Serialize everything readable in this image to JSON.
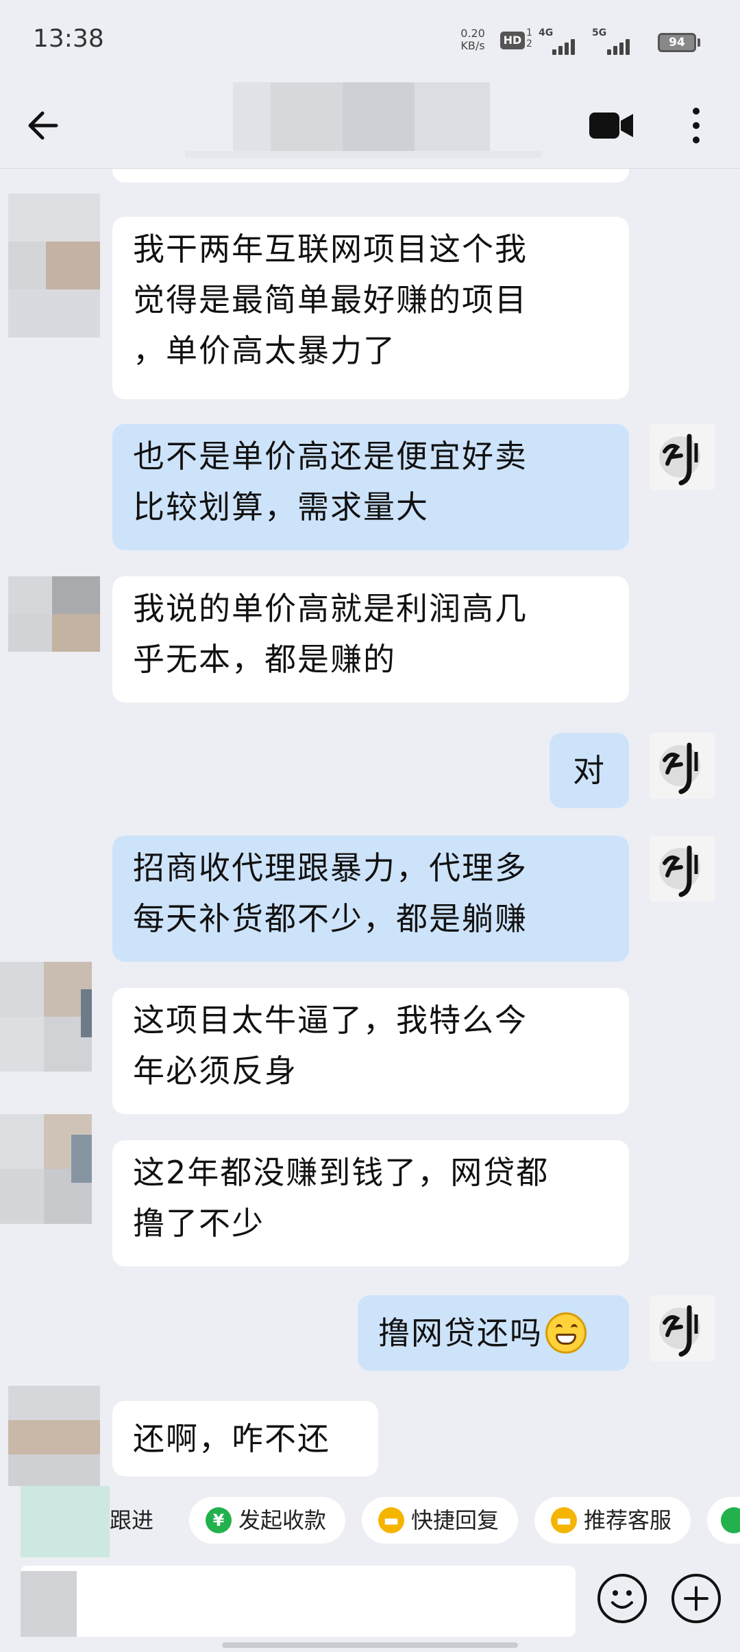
{
  "status_bar": {
    "time": "13:38",
    "net_speed_value": "0.20",
    "net_speed_unit": "KB/s",
    "hd_label": "HD",
    "sim_numbers": "1\n2",
    "signal_1_label": "4G",
    "signal_2_label": "5G",
    "battery": "94"
  },
  "header": {
    "back_icon": "arrow-left",
    "video_icon": "video-camera",
    "more_icon": "vertical-dots"
  },
  "messages": [
    {
      "side": "in",
      "lines": [
        "我干两年互联网项目这个我",
        "觉得是最简单最好赚的项目",
        "，单价高太暴力了"
      ]
    },
    {
      "side": "out",
      "lines": [
        "也不是单价高还是便宜好卖",
        "比较划算，需求量大"
      ]
    },
    {
      "side": "in",
      "lines": [
        "我说的单价高就是利润高几",
        "乎无本，都是赚的"
      ]
    },
    {
      "side": "out",
      "lines": [
        "对"
      ]
    },
    {
      "side": "out",
      "lines": [
        "招商收代理跟暴力，代理多",
        "每天补货都不少，都是躺赚"
      ]
    },
    {
      "side": "in",
      "lines": [
        "这项目太牛逼了，我特么今",
        "年必须反身"
      ]
    },
    {
      "side": "in",
      "lines": [
        "这2年都没赚到钱了，网贷都",
        "撸了不少"
      ]
    },
    {
      "side": "out",
      "lines": [
        "撸网贷还吗"
      ],
      "emoji": "grinning-face"
    },
    {
      "side": "in",
      "lines": [
        "还啊，咋不还"
      ]
    }
  ],
  "quick_actions": [
    {
      "label": "跟进",
      "icon": "none"
    },
    {
      "label": "发起收款",
      "icon": "yen-coin"
    },
    {
      "label": "快捷回复",
      "icon": "chat-bubble"
    },
    {
      "label": "推荐客服",
      "icon": "chat-bubble"
    }
  ],
  "input": {
    "value": "",
    "emoji_icon": "smiley-face",
    "plus_icon": "plus"
  },
  "colors": {
    "background": "#eceef3",
    "incoming_bubble": "#ffffff",
    "outgoing_bubble": "#cde3fa",
    "yen_icon": "#22b14c",
    "reply_icon": "#f5b400"
  }
}
